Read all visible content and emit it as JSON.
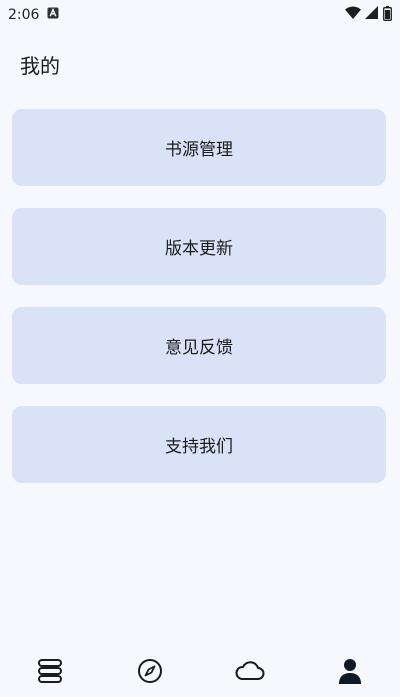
{
  "status_bar": {
    "time": "2:06",
    "notification_icon": "a-box-icon",
    "wifi_icon": "wifi-icon",
    "signal_icon": "cell-signal-icon",
    "battery_icon": "battery-icon"
  },
  "page": {
    "title": "我的"
  },
  "menu": {
    "items": [
      {
        "label": "书源管理"
      },
      {
        "label": "版本更新"
      },
      {
        "label": "意见反馈"
      },
      {
        "label": "支持我们"
      }
    ]
  },
  "bottom_nav": {
    "items": [
      {
        "icon": "bookshelf-icon"
      },
      {
        "icon": "compass-icon"
      },
      {
        "icon": "cloud-icon"
      },
      {
        "icon": "person-icon",
        "active": true
      }
    ]
  },
  "colors": {
    "background": "#f7f8fd",
    "card": "#d9e2f6",
    "text": "#1b1b1b",
    "icon": "#1b1b1b"
  }
}
